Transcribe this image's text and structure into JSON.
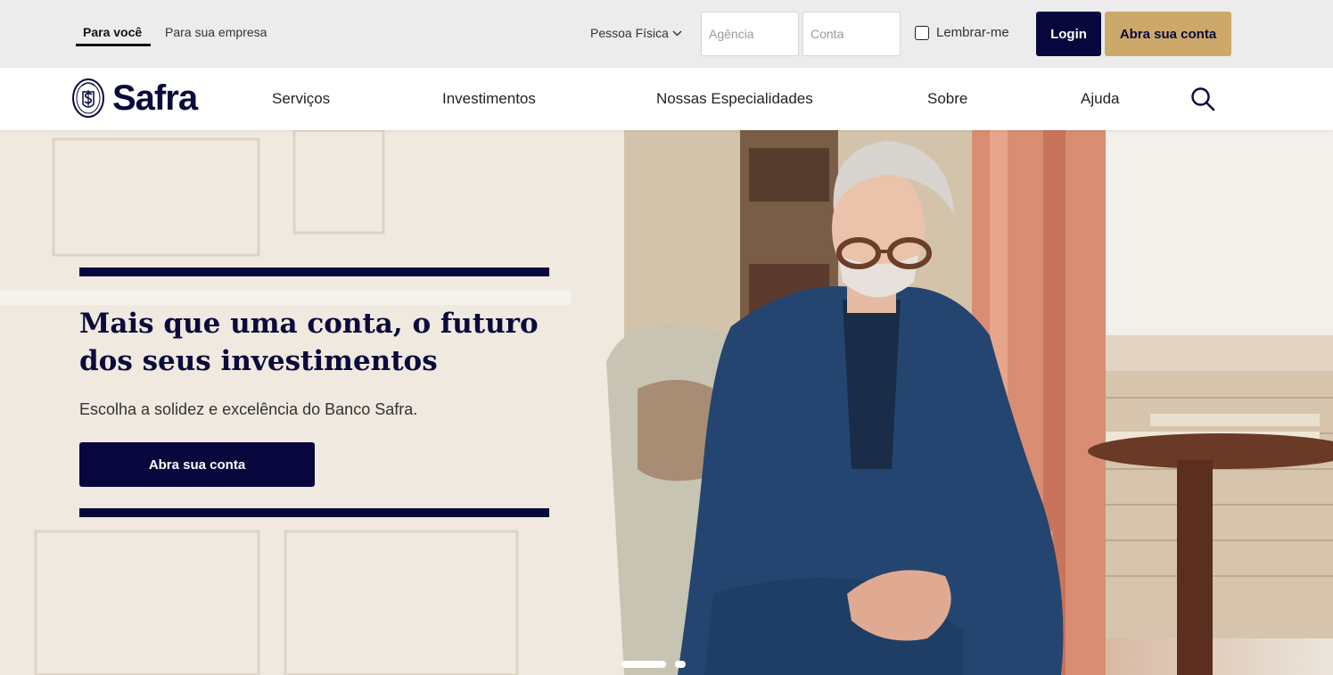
{
  "topbar": {
    "segments": [
      {
        "label": "Para você",
        "active": true
      },
      {
        "label": "Para sua empresa",
        "active": false
      }
    ],
    "person_type": "Pessoa Física",
    "agency_placeholder": "Agência",
    "account_placeholder": "Conta",
    "remember_label": "Lembrar-me",
    "login_label": "Login",
    "open_account_label": "Abra sua conta"
  },
  "nav": {
    "brand": "Safra",
    "items": [
      "Serviços",
      "Investimentos",
      "Nossas Especialidades",
      "Sobre",
      "Ajuda"
    ]
  },
  "hero": {
    "headline_bold": "Mais que uma conta,",
    "headline_rest": " o futuro dos seus investimentos",
    "subline": "Escolha a solidez e excelência do Banco Safra.",
    "cta_label": "Abra sua conta",
    "carousel": {
      "slides": 2,
      "active_index": 0
    }
  },
  "colors": {
    "navy": "#07073d",
    "gold": "#cca96a",
    "topbar_bg": "#ececec"
  },
  "icons": [
    "chevron-down-icon",
    "search-icon",
    "safra-seal-logo"
  ]
}
